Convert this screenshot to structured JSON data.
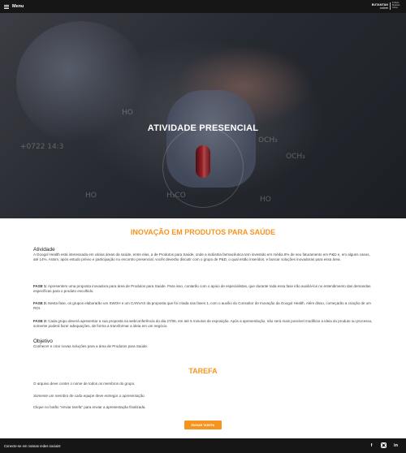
{
  "topbar": {
    "menu_label": "Menu",
    "brand_name": "BUTANTAN",
    "brand_sub": "online",
    "brand_tag": "Instituto Butantan Online"
  },
  "hero": {
    "title": "ATIVIDADE PRESENCIAL"
  },
  "main": {
    "title": "INOVAÇÃO EM PRODUTOS PARA SAÚDE",
    "atividade_heading": "Atividade",
    "atividade_text": "A Googol Health está interessada em várias áreas da saúde, entre elas, a de Produtos para Saúde, onde a indústria farmacêutica tem investido em média 8% de seu faturamento em P&D e, em alguns casos, até 14%. Assim, após estudo prévio e participação no encontro presencial, vocês deverão discutir com o grupo de P&D, o qual estão inseridos, e buscar soluções inovadoras para essa área.",
    "fase1_label": "FASE 1:",
    "fase1_text": " Apresentem uma proposta inovadora para área de Produtos para Saúde. Para isso, contarão com o apoio de especialistas, que durante toda essa fase irão auxiliá-los no entendimento das demandas específicas para o produto escolhido.",
    "fase2_label": "FASE 2:",
    "fase2_text": " Nesta fase, os grupos elaborarão um SWOH e um CANVAS da proposta que foi criada nas fases 1, com o auxílio do Consultor de Inovação da Googol Health. Além disso, começarão a criação de um ROI.",
    "fase3_label": "FASE 3:",
    "fase3_text": " Cada grupo deverá apresentar a sua proposta na webconferência do dia 27/06, em até 5 minutos de exposição. Após a apresentação, não será mais possível modificar a ideia do produto ou processo, somente poderá fazer adequações, de forma a transformar a ideia em um negócio.",
    "objetivo_heading": "Objetivo",
    "objetivo_text": "Conhecer e criar novas soluções para a área de Produtos para Saúde."
  },
  "tarefa": {
    "title": "TAREFA",
    "line1": "O arquivo deve conter o nome de todos os membros do grupo.",
    "line2": "Somente um membro de cada equipe deve entregar a apresentação.",
    "line3": "Clique no botão \"enviar tarefa\" para enviar a apresentação finalizada.",
    "button_label": "ENVIAR TAREFA"
  },
  "footer": {
    "text": "Conecte-se em nossas redes sociais!",
    "social": [
      "facebook-icon",
      "instagram-icon",
      "linkedin-icon"
    ]
  },
  "colors": {
    "accent": "#f7941d",
    "bar": "#161616"
  }
}
